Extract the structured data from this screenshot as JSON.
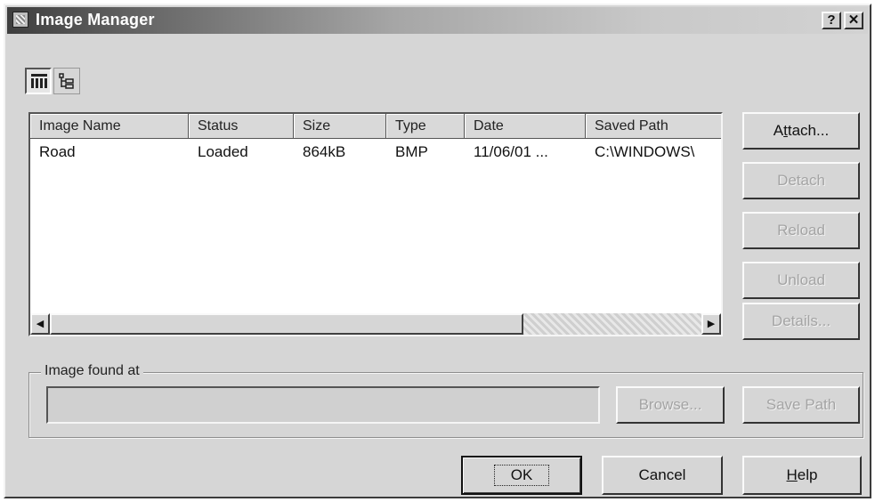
{
  "window": {
    "title": "Image Manager",
    "help_glyph": "?",
    "close_glyph": "✕"
  },
  "view_toggles": [
    {
      "name": "list-view-icon",
      "active": true
    },
    {
      "name": "tree-view-icon",
      "active": false
    }
  ],
  "table": {
    "columns": [
      "Image Name",
      "Status",
      "Size",
      "Type",
      "Date",
      "Saved Path"
    ],
    "rows": [
      [
        "Road",
        "Loaded",
        "864kB",
        "BMP",
        "11/06/01 ...",
        "C:\\WINDOWS\\"
      ]
    ]
  },
  "side_buttons": [
    {
      "label_pre": "A",
      "label_accel": "t",
      "label_post": "tach...",
      "enabled": true
    },
    {
      "label": "Detach",
      "enabled": false
    },
    {
      "label": "Reload",
      "enabled": false
    },
    {
      "label": "Unload",
      "enabled": false
    },
    {
      "label": "Details...",
      "enabled": false
    }
  ],
  "found_at": {
    "label": "Image found at",
    "value": ""
  },
  "found_buttons": {
    "browse": "Browse...",
    "save_path": "Save Path"
  },
  "bottom_buttons": {
    "ok": "OK",
    "cancel": "Cancel",
    "help_accel": "H",
    "help_rest": "elp"
  }
}
